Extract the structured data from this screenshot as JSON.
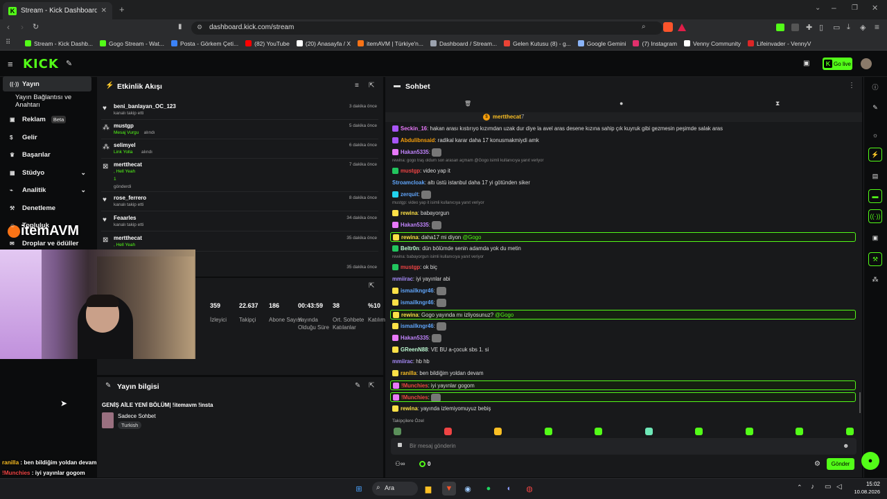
{
  "browser": {
    "tab_title": "Stream - Kick Dashboard",
    "url": "dashboard.kick.com/stream",
    "bookmarks": [
      {
        "label": "Stream - Kick Dashb...",
        "color": "#53fc18"
      },
      {
        "label": "Gogo Stream - Wat...",
        "color": "#53fc18"
      },
      {
        "label": "Posta - Görkem Çeti...",
        "color": "#3b82f6"
      },
      {
        "label": "(82) YouTube",
        "color": "#ff0000"
      },
      {
        "label": "(20) Anasayfa / X",
        "color": "#ffffff"
      },
      {
        "label": "itemAVM | Türkiye'n...",
        "color": "#f97316"
      },
      {
        "label": "Dashboard / Stream...",
        "color": "#9ca3af"
      },
      {
        "label": "Gelen Kutusu (8) - g...",
        "color": "#ea4335"
      },
      {
        "label": "Google Gemini",
        "color": "#8ab4f8"
      },
      {
        "label": "(7) Instagram",
        "color": "#e1306c"
      },
      {
        "label": "Venny Community",
        "color": "#ffffff"
      },
      {
        "label": "Lifeinvader - VennyV",
        "color": "#dc2626"
      }
    ]
  },
  "nav": {
    "logo": "KICK",
    "go_live": "Go live"
  },
  "sidebar": {
    "items": [
      {
        "label": "Yayın",
        "icon": "broadcast-icon"
      },
      {
        "label": "Yayın Bağlantısı ve Anahtarı",
        "icon": ""
      },
      {
        "label": "Reklam",
        "badge": "Beta",
        "icon": "ad-icon"
      },
      {
        "label": "Gelir",
        "icon": "dollar-icon"
      },
      {
        "label": "Başarılar",
        "icon": "trophy-icon"
      },
      {
        "label": "Stüdyo",
        "icon": "studio-icon"
      },
      {
        "label": "Analitik",
        "icon": "chart-icon"
      },
      {
        "label": "Denetleme",
        "icon": "hammer-icon"
      },
      {
        "label": "Topluluk",
        "icon": "community-icon"
      },
      {
        "label": "Droplar ve ödüller",
        "icon": "gift-icon"
      }
    ]
  },
  "activity": {
    "title": "Etkinlik Akışı",
    "events": [
      {
        "name": "beni_banlayan_OC_123",
        "sub": "kanalı takip etti",
        "time": "3 dakika önce",
        "icon": "heart-icon"
      },
      {
        "name": "mustgp",
        "sub": "Mesaj Vurgu",
        "sub2": "alındı",
        "time": "5 dakika önce",
        "icon": "reward-icon"
      },
      {
        "name": "selimyel",
        "sub": "Link Yolla",
        "sub2": "alındı",
        "time": "6 dakika önce",
        "icon": "reward-icon"
      },
      {
        "name": "mertthecat",
        "sub": ", Hell Yeah",
        "sub2": "gönderdi",
        "count": "1",
        "time": "7 dakika önce",
        "icon": "kick-icon"
      },
      {
        "name": "rose_ferrero",
        "sub": "kanalı takip etti",
        "time": "8 dakika önce",
        "icon": "heart-icon"
      },
      {
        "name": "Feaarles",
        "sub": "kanalı takip etti",
        "time": "34 dakika önce",
        "icon": "heart-icon"
      },
      {
        "name": "mertthecat",
        "sub": ", Hell Yeah",
        "time": "35 dakika önce",
        "icon": "kick-icon"
      },
      {
        "name": "",
        "sub": "",
        "time": "35 dakika önce",
        "icon": ""
      }
    ]
  },
  "stats": [
    {
      "value": "359",
      "label": "İzleyici"
    },
    {
      "value": "22.637",
      "label": "Takipçi"
    },
    {
      "value": "186",
      "label": "Abone Sayısı"
    },
    {
      "value": "00:43:59",
      "label": "Yayında Olduğu Süre"
    },
    {
      "value": "38",
      "label": "Ort. Sohbete Katılanlar"
    },
    {
      "value": "%10",
      "label": "Katılım"
    }
  ],
  "stream_info": {
    "title": "Yayın bilgisi",
    "stream_title": "GENİŞ AİLE YENİ BÖLÜM| !itemavm !insta",
    "category": "Sadece Sohbet",
    "tag": "Turkish"
  },
  "chat": {
    "title": "Sohbet",
    "pinned_user": "mertthecat",
    "pinned_count": "7",
    "followers_only": "Takipçilere Özel",
    "placeholder": "Bir mesaj gönderin",
    "send": "Gönder",
    "bottom_count": "0",
    "messages": [
      {
        "user": "Seckin_16",
        "color": "#e879f9",
        "text": "hakan arası kıstırıyo kızımdan uzak dur diye la avel aras desene kızına sahip çık kuyruk gibi gezmesin peşimde salak aras",
        "badge": "#a855f7"
      },
      {
        "user": "Abdulibnsaid",
        "color": "#f59e0b",
        "text": "radikal karar daha 17 konusmakmiydi amk",
        "badge": "#a855f7"
      },
      {
        "user": "Hakan5335",
        "color": "#c084fc",
        "text": "",
        "emote": true,
        "badge": "#e879f9"
      },
      {
        "reply": "rewina: gogo traş oldum son arasan açmam @Gogo isimli kullanıcıya yanıt veriyor"
      },
      {
        "user": "mustgp",
        "color": "#ef4444",
        "text": "video yap it",
        "badge": "#22c55e"
      },
      {
        "user": "Stroamcloak",
        "color": "#60a5fa",
        "text": "altı üstü istanbul daha 17 yi götünden siker"
      },
      {
        "user": "zerquit",
        "color": "#60a5fa",
        "text": "",
        "emote": true,
        "badge": "#22d3ee"
      },
      {
        "reply": "mustgp: video yap it isimli kullanıcıya yanıt veriyor"
      },
      {
        "user": "rewina",
        "color": "#fde047",
        "text": "babayorgun",
        "badge": "#fde047"
      },
      {
        "user": "Hakan5335",
        "color": "#c084fc",
        "text": "",
        "emote": true,
        "badge": "#e879f9"
      },
      {
        "user": "rewina",
        "color": "#fde047",
        "text": "daha17 mi diyon",
        "mention": "@Gogo",
        "hl": true,
        "badge": "#fde047"
      },
      {
        "user": "Beltr0n",
        "color": "#bbf7d0",
        "text": "dün bölümde senin adamda yok du metin",
        "badge": "#22c55e"
      },
      {
        "reply": "rewina: babayorgun isimli kullanıcıya yanıt veriyor"
      },
      {
        "user": "mustgp",
        "color": "#ef4444",
        "text": "ok biç",
        "badge": "#22c55e"
      },
      {
        "user": "mmiirac",
        "color": "#a78bfa",
        "text": "iyi yayınlar abi"
      },
      {
        "user": "ismailkngr46",
        "color": "#60a5fa",
        "text": "",
        "emote": true,
        "badge": "#fde047"
      },
      {
        "user": "ismailkngr46",
        "color": "#60a5fa",
        "text": "",
        "emote": true,
        "badge": "#fde047"
      },
      {
        "user": "rewina",
        "color": "#fde047",
        "text": "Gogo yayında mı izliyosunuz?",
        "mention": "@Gogo",
        "hl": true,
        "badge": "#fde047"
      },
      {
        "user": "ismailkngr46",
        "color": "#60a5fa",
        "text": "",
        "emote": true,
        "badge": "#fde047"
      },
      {
        "user": "Hakan5335",
        "color": "#c084fc",
        "text": "",
        "emote": true,
        "badge": "#e879f9"
      },
      {
        "user": "GReenN88",
        "color": "#bbf7d0",
        "text": "VE BU a-çocuk sbs 1. si",
        "badge": "#fde047"
      },
      {
        "user": "mmiirac",
        "color": "#a78bfa",
        "text": "hb hb"
      },
      {
        "user": "ranilla",
        "color": "#fbbf24",
        "text": "ben bildiğim yoldan devam",
        "badge": "#fde047"
      },
      {
        "user": "!Munchies",
        "color": "#ef4444",
        "text": "iyi yayınlar gogom",
        "hl": true,
        "badge": "#e879f9"
      },
      {
        "user": "!Munchies",
        "color": "#ef4444",
        "text": "",
        "emote": true,
        "hl": true,
        "badge": "#e879f9"
      },
      {
        "user": "rewina",
        "color": "#fde047",
        "text": "yayında izlemiyomuyuz bebiş",
        "badge": "#fde047"
      }
    ]
  },
  "overlay": {
    "brand": "itemAVM",
    "chat": [
      {
        "user": "ranilla",
        "text": "ben bildiğim yoldan devam",
        "color": "#fbbf24"
      },
      {
        "user": "!Munchies",
        "text": "iyi yayınlar gogom",
        "color": "#ef4444"
      },
      {
        "user": "!Munchies",
        "text": "",
        "color": "#ef4444"
      },
      {
        "user": "rewina",
        "text": "yayında izlemiyomuyuz bebiş",
        "color": "#fde047"
      }
    ]
  },
  "taskbar": {
    "search": "Ara",
    "time": "15:02",
    "date": "10.08.2026"
  },
  "colors": {
    "accent": "#53fc18",
    "panel": "#18191b",
    "bg": "#0b0c0d"
  }
}
